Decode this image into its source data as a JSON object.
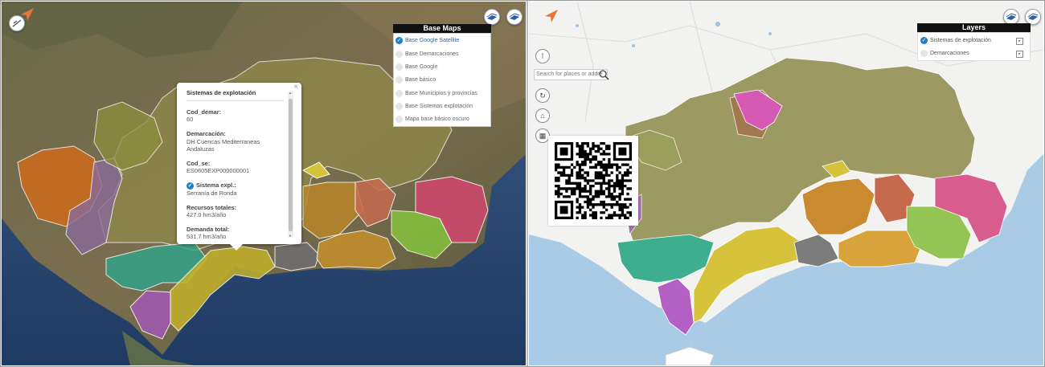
{
  "left_map": {
    "popup": {
      "title": "Sistemas de explotación",
      "close": "×",
      "fields": [
        {
          "label": "Cod_demar:",
          "value": "60"
        },
        {
          "label": "Demarcación:",
          "value": "DH Cuencas Mediterraneas Andaluzas"
        },
        {
          "label": "Cod_se:",
          "value": "ES0605EXP000000001"
        },
        {
          "label": "Sistema expl.:",
          "value": "Serranía de Ronda"
        },
        {
          "label": "Recursos totales:",
          "value": "427.0 hm3/año"
        },
        {
          "label": "Demanda total:",
          "value": "531.7 hm3/año"
        }
      ],
      "scroll_up": "▲",
      "scroll_down": "▼"
    },
    "base_maps": {
      "title": "Base Maps",
      "items": [
        {
          "label": "Base Google Satellite",
          "selected": true
        },
        {
          "label": "Base Demarcaciones",
          "selected": false
        },
        {
          "label": "Base Google",
          "selected": false
        },
        {
          "label": "Base básico",
          "selected": false
        },
        {
          "label": "Base Municipios y provincias",
          "selected": false
        },
        {
          "label": "Base Sistemas explotación",
          "selected": false
        },
        {
          "label": "Mapa base básico oscuro",
          "selected": false
        }
      ]
    }
  },
  "right_map": {
    "layers": {
      "title": "Layers",
      "items": [
        {
          "label": "Sistemas de explotación",
          "checked": true
        },
        {
          "label": "Demarcaciones",
          "checked": false
        }
      ]
    },
    "search": {
      "placeholder": "Search for places or addre"
    }
  },
  "colors": {
    "accent": "#1e7fc6",
    "compass": "#e8743b",
    "land_light": "#f2f2f0",
    "sea": "#a9cbe6",
    "olive": "#8f8a4a",
    "teal": "#3daf8f",
    "purple": "#a266b5",
    "yellow": "#d7c23c",
    "orange": "#c98a30",
    "pink": "#d95d8c",
    "green": "#94c454",
    "magenta": "#d659b4",
    "gray": "#7c7c7c"
  }
}
